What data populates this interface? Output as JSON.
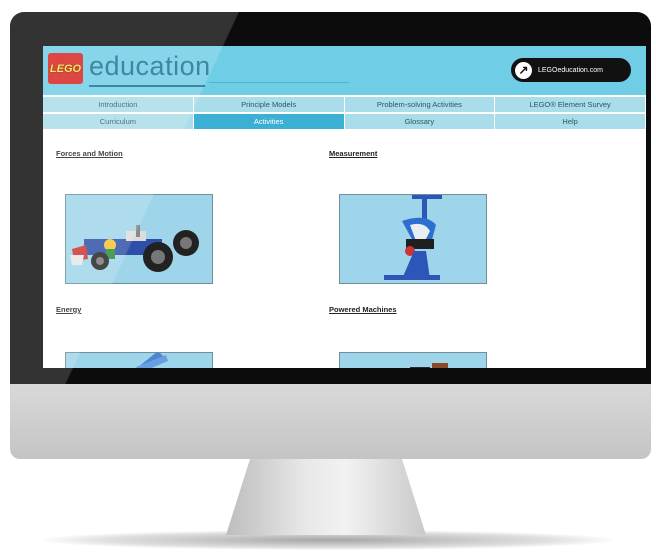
{
  "header": {
    "logo_text": "LEGO",
    "brand": "education",
    "site_link": "LEGOeducation.com"
  },
  "nav": {
    "row1": [
      "Introduction",
      "Principle Models",
      "Problem-solving Activities",
      "LEGO® Element Survey"
    ],
    "row2": [
      "Curriculum",
      "Activities",
      "Glossary",
      "Help"
    ],
    "active": "Activities"
  },
  "sections": [
    {
      "title": "Forces and Motion"
    },
    {
      "title": "Measurement"
    },
    {
      "title": "Energy"
    },
    {
      "title": "Powered Machines"
    }
  ],
  "colors": {
    "banner": "#6fcde6",
    "brand_text": "#1c6f8e",
    "nav_tab": "#a9dde9",
    "nav_tab_active": "#3bb0d4",
    "logo_red": "#d6231f",
    "logo_yellow": "#ffe23a",
    "thumb_background": "#9fd5ea"
  }
}
